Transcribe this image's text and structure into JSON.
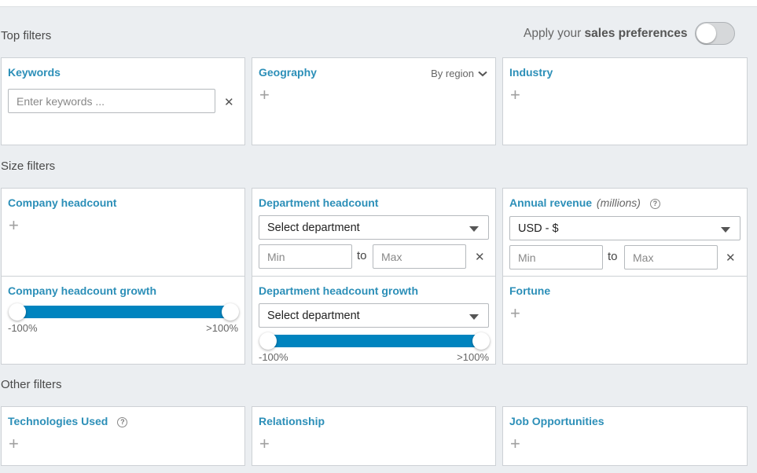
{
  "sections": {
    "top": "Top filters",
    "size": "Size filters",
    "other": "Other filters"
  },
  "preferences": {
    "prefix": "Apply your ",
    "bold": "sales preferences",
    "toggle_on": false
  },
  "keywords": {
    "title": "Keywords",
    "placeholder": "Enter keywords ..."
  },
  "geography": {
    "title": "Geography",
    "mode": "By region"
  },
  "industry": {
    "title": "Industry"
  },
  "company_headcount": {
    "title": "Company headcount"
  },
  "department_headcount": {
    "title": "Department headcount",
    "select": "Select department",
    "min_placeholder": "Min",
    "to": "to",
    "max_placeholder": "Max"
  },
  "annual_revenue": {
    "title": "Annual revenue",
    "unit": "(millions)",
    "currency": "USD - $",
    "min_placeholder": "Min",
    "to": "to",
    "max_placeholder": "Max"
  },
  "company_headcount_growth": {
    "title": "Company headcount growth",
    "min_label": "-100%",
    "max_label": ">100%",
    "range_low_pct": 0,
    "range_high_pct": 100
  },
  "department_headcount_growth": {
    "title": "Department headcount growth",
    "select": "Select department",
    "min_label": "-100%",
    "max_label": ">100%",
    "range_low_pct": 0,
    "range_high_pct": 100
  },
  "fortune": {
    "title": "Fortune"
  },
  "technologies_used": {
    "title": "Technologies Used"
  },
  "relationship": {
    "title": "Relationship"
  },
  "job_opportunities": {
    "title": "Job Opportunities"
  },
  "icons": {
    "plus": "+",
    "clear": "✕",
    "help": "?"
  },
  "colors": {
    "accent": "#0084bf",
    "title_blue": "#2c8fb8",
    "background": "#ebeef1"
  }
}
